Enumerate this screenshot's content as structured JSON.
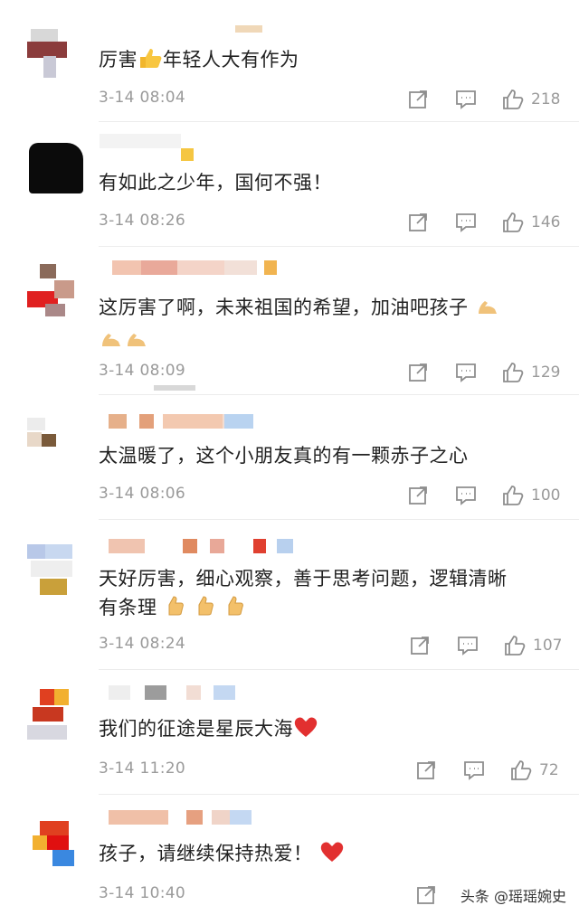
{
  "comments": [
    {
      "text": "厉害",
      "text_after": "年轻人大有作为",
      "time": "3-14 08:04",
      "likes": "218"
    },
    {
      "text": "有如此之少年，国何不强！",
      "time": "3-14 08:26",
      "likes": "146"
    },
    {
      "text": "这厉害了啊，未来祖国的希望，加油吧孩子",
      "time": "3-14 08:09",
      "likes": "129"
    },
    {
      "text": "太温暖了，这个小朋友真的有一颗赤子之心",
      "time": "3-14 08:06",
      "likes": "100"
    },
    {
      "text": "天好厉害，细心观察，善于思考问题，逻辑清晰",
      "text_line2": "有条理",
      "time": "3-14 08:24",
      "likes": "107"
    },
    {
      "text": "我们的征途是星辰大海",
      "time": "3-14 11:20",
      "likes": "72"
    },
    {
      "text": "孩子，请继续保持热爱！",
      "time": "3-14 10:40",
      "likes": ""
    }
  ],
  "icons": {
    "share": "share-icon",
    "comment": "comment-icon",
    "like": "thumbs-up-icon"
  },
  "watermark": "头条 @瑶瑶婉史"
}
